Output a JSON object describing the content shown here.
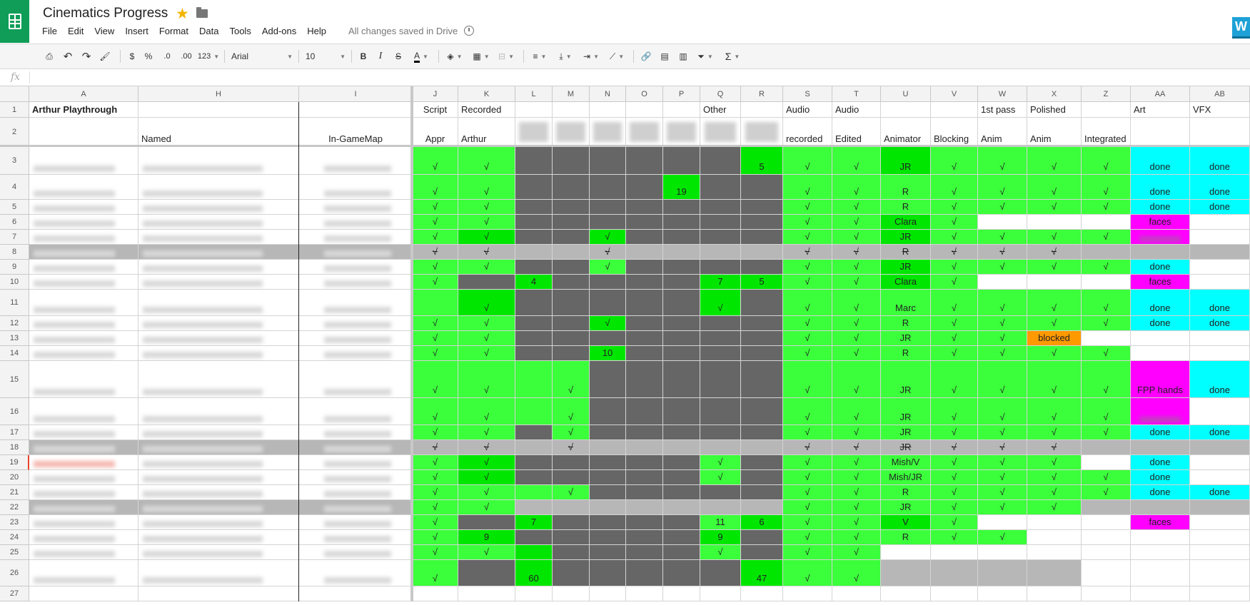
{
  "app": {
    "doc_title": "Cinematics Progress",
    "saved_status": "All changes saved in Drive",
    "avatar_letter": "W",
    "menus": [
      "File",
      "Edit",
      "View",
      "Insert",
      "Format",
      "Data",
      "Tools",
      "Add-ons",
      "Help"
    ]
  },
  "toolbar": {
    "currency": "$",
    "percent": "%",
    "dec_less": ".0",
    "dec_more": ".00",
    "more_formats": "123",
    "font": "Arial",
    "font_size": "10",
    "bold": "B",
    "italic": "I",
    "strike": "S",
    "text_color": "A",
    "sum": "Σ"
  },
  "formula_bar": {
    "fx": "fx",
    "value": ""
  },
  "columns": [
    "A",
    "H",
    "I",
    "J",
    "K",
    "L",
    "M",
    "N",
    "O",
    "P",
    "Q",
    "R",
    "S",
    "T",
    "U",
    "V",
    "W",
    "X",
    "Z",
    "AA",
    "AB"
  ],
  "header_row1": {
    "A": "Arthur Playthrough",
    "J": "Script",
    "K": "Recorded",
    "Q": "Other",
    "S": "Audio",
    "T": "Audio",
    "W": "1st pass",
    "X": "Polished",
    "AA": "Art",
    "AB": "VFX"
  },
  "header_row2": {
    "H": "Named",
    "I": "In-GameMap",
    "J": "Appr",
    "K": "Arthur",
    "S": "recorded",
    "T": "Edited",
    "U": "Animator",
    "V": "Blocking",
    "W": "Anim",
    "X": "Anim",
    "Z": "Integrated"
  },
  "rows": [
    {
      "n": "3",
      "J": "√",
      "K": "√",
      "R": "5",
      "S": "√",
      "T": "√",
      "U": "JR",
      "V": "√",
      "W": "√",
      "X": "√",
      "Z": "√",
      "AA": "done",
      "AB": "done"
    },
    {
      "n": "4",
      "J": "√",
      "K": "√",
      "P": "19",
      "S": "√",
      "T": "√",
      "U": "R",
      "V": "√",
      "W": "√",
      "X": "√",
      "Z": "√",
      "AA": "done",
      "AB": "done"
    },
    {
      "n": "5",
      "J": "√",
      "K": "√",
      "S": "√",
      "T": "√",
      "U": "R",
      "V": "√",
      "W": "√",
      "X": "√",
      "Z": "√",
      "AA": "done",
      "AB": "done"
    },
    {
      "n": "6",
      "J": "√",
      "K": "√",
      "S": "√",
      "T": "√",
      "U": "Clara",
      "V": "√",
      "AA": "faces"
    },
    {
      "n": "7",
      "J": "√",
      "K": "√",
      "N": "√",
      "S": "√",
      "T": "√",
      "U": "JR",
      "V": "√",
      "W": "√",
      "X": "√",
      "Z": "√"
    },
    {
      "n": "8",
      "J": "√",
      "K": "√",
      "N": "√",
      "S": "√",
      "T": "√",
      "U": "R",
      "V": "√",
      "W": "√",
      "X": "√"
    },
    {
      "n": "9",
      "J": "√",
      "K": "√",
      "N": "√",
      "S": "√",
      "T": "√",
      "U": "JR",
      "V": "√",
      "W": "√",
      "X": "√",
      "Z": "√",
      "AA": "done"
    },
    {
      "n": "10",
      "J": "√",
      "L": "4",
      "Q": "7",
      "R": "5",
      "S": "√",
      "T": "√",
      "U": "Clara",
      "V": "√",
      "AA": "faces"
    },
    {
      "n": "11",
      "K": "√",
      "Q": "√",
      "S": "√",
      "T": "√",
      "U": "Marc",
      "V": "√",
      "W": "√",
      "X": "√",
      "Z": "√",
      "AA": "done",
      "AB": "done"
    },
    {
      "n": "12",
      "J": "√",
      "K": "√",
      "N": "√",
      "S": "√",
      "T": "√",
      "U": "R",
      "V": "√",
      "W": "√",
      "X": "√",
      "Z": "√",
      "AA": "done",
      "AB": "done"
    },
    {
      "n": "13",
      "J": "√",
      "K": "√",
      "S": "√",
      "T": "√",
      "U": "JR",
      "V": "√",
      "W": "√",
      "X": "blocked"
    },
    {
      "n": "14",
      "J": "√",
      "K": "√",
      "N": "10",
      "S": "√",
      "T": "√",
      "U": "R",
      "V": "√",
      "W": "√",
      "X": "√",
      "Z": "√"
    },
    {
      "n": "15",
      "J": "√",
      "K": "√",
      "M": "√",
      "S": "√",
      "T": "√",
      "U": "JR",
      "V": "√",
      "W": "√",
      "X": "√",
      "Z": "√",
      "AA": "FPP hands",
      "AB": "done"
    },
    {
      "n": "16",
      "J": "√",
      "K": "√",
      "M": "√",
      "S": "√",
      "T": "√",
      "U": "JR",
      "V": "√",
      "W": "√",
      "X": "√",
      "Z": "√"
    },
    {
      "n": "17",
      "J": "√",
      "K": "√",
      "M": "√",
      "S": "√",
      "T": "√",
      "U": "JR",
      "V": "√",
      "W": "√",
      "X": "√",
      "Z": "√",
      "AA": "done",
      "AB": "done"
    },
    {
      "n": "18",
      "J": "√",
      "K": "√",
      "M": "√",
      "S": "√",
      "T": "√",
      "U": "JR",
      "V": "√",
      "W": "√",
      "X": "√"
    },
    {
      "n": "19",
      "J": "√",
      "K": "√",
      "Q": "√",
      "S": "√",
      "T": "√",
      "U": "Mish/V",
      "V": "√",
      "W": "√",
      "X": "√",
      "AA": "done"
    },
    {
      "n": "20",
      "J": "√",
      "K": "√",
      "Q": "√",
      "S": "√",
      "T": "√",
      "U": "Mish/JR",
      "V": "√",
      "W": "√",
      "X": "√",
      "Z": "√",
      "AA": "done"
    },
    {
      "n": "21",
      "J": "√",
      "K": "√",
      "M": "√",
      "S": "√",
      "T": "√",
      "U": "R",
      "V": "√",
      "W": "√",
      "X": "√",
      "Z": "√",
      "AA": "done",
      "AB": "done"
    },
    {
      "n": "22",
      "J": "√",
      "K": "√",
      "S": "√",
      "T": "√",
      "U": "JR",
      "V": "√",
      "W": "√",
      "X": "√"
    },
    {
      "n": "23",
      "J": "√",
      "L": "7",
      "Q": "11",
      "R": "6",
      "S": "√",
      "T": "√",
      "U": "V",
      "V": "√",
      "AA": "faces"
    },
    {
      "n": "24",
      "J": "√",
      "K": "9",
      "Q": "9",
      "S": "√",
      "T": "√",
      "U": "R",
      "V": "√",
      "W": "√"
    },
    {
      "n": "25",
      "J": "√",
      "K": "√",
      "Q": "√",
      "S": "√",
      "T": "√"
    },
    {
      "n": "26",
      "J": "√",
      "L": "60",
      "R": "47",
      "S": "√",
      "T": "√"
    },
    {
      "n": "27"
    }
  ]
}
